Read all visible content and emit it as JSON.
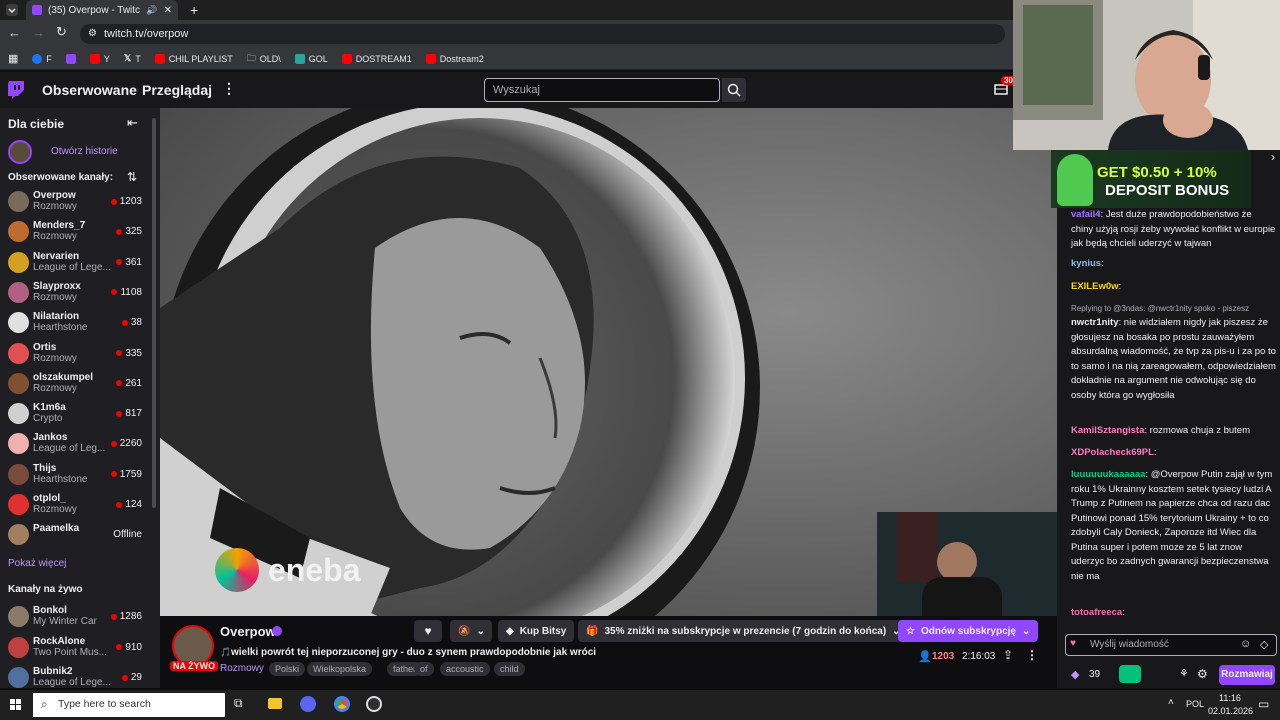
{
  "browser": {
    "tab_title": "(35) Overpow - Twitch",
    "url": "twitch.tv/overpow",
    "bookmarks": [
      {
        "label": "F",
        "color": "#1877f2"
      },
      {
        "label": "",
        "color": "#9146ff"
      },
      {
        "label": "Y",
        "color": "#ff0000"
      },
      {
        "label": "T",
        "color": "#ffffff"
      },
      {
        "label": "CHIL PLAYLIST",
        "color": "#ff0000"
      },
      {
        "label": "OLD\\",
        "color": "#e8eaed"
      },
      {
        "label": "GOL",
        "color": "#26a69a"
      },
      {
        "label": "DOSTREAM1",
        "color": "#ff0000"
      },
      {
        "label": "Dostream2",
        "color": "#ff0000"
      }
    ]
  },
  "nav": {
    "followed": "Obserwowane",
    "browse": "Przeglądaj",
    "search_placeholder": "Wyszukaj",
    "notif_count": "30"
  },
  "sidebar": {
    "for_you": "Dla ciebie",
    "open_stories": "Otwórz historie",
    "followed_header": "Obserwowane kanały:",
    "channels": [
      {
        "name": "Overpow",
        "game": "Rozmowy",
        "viewers": "1203",
        "color": "#7a6a5a"
      },
      {
        "name": "Menders_7",
        "game": "Rozmowy",
        "viewers": "325",
        "color": "#c06a30"
      },
      {
        "name": "Nervarien",
        "game": "League of Lege...",
        "viewers": "361",
        "color": "#d4a020"
      },
      {
        "name": "Slayproxx",
        "game": "Rozmowy",
        "viewers": "1108",
        "color": "#b06080"
      },
      {
        "name": "Nilatarion",
        "game": "Hearthstone",
        "viewers": "38",
        "color": "#e0e0e0"
      },
      {
        "name": "Ortis",
        "game": "Rozmowy",
        "viewers": "335",
        "color": "#e05050"
      },
      {
        "name": "olszakumpel",
        "game": "Rozmowy",
        "viewers": "261",
        "color": "#805030"
      },
      {
        "name": "K1m6a",
        "game": "Crypto",
        "viewers": "817",
        "color": "#d0d0d0"
      },
      {
        "name": "Jankos",
        "game": "League of Leg...",
        "viewers": "2260",
        "color": "#f0b0b0"
      },
      {
        "name": "Thijs",
        "game": "Hearthstone",
        "viewers": "1759",
        "color": "#7a4a3a"
      },
      {
        "name": "otplol_",
        "game": "Rozmowy",
        "viewers": "124",
        "color": "#e03030"
      },
      {
        "name": "Paamelka",
        "game": "",
        "viewers": "Offline",
        "color": "#a08060"
      }
    ],
    "show_more": "Pokaż więcej",
    "live_header": "Kanały na żywo",
    "live_channels": [
      {
        "name": "Bonkol",
        "game": "My Winter Car",
        "viewers": "1286",
        "color": "#8a7a6a"
      },
      {
        "name": "RockAlone",
        "game": "Two Point Mus...",
        "viewers": "910",
        "color": "#c04040"
      },
      {
        "name": "Bubnik2",
        "game": "League of Lege...",
        "viewers": "29",
        "color": "#5070a0"
      }
    ]
  },
  "video": {
    "watermark": "eneba"
  },
  "stream": {
    "channel": "Overpow",
    "live_badge": "NA ŻYWO",
    "title": "wielki powrót tej nieporzuconej gry - duo z synem prawdopodobnie jak wróci",
    "category": "Rozmowy",
    "tags": [
      "Polski",
      "Wielkopolska",
      "father",
      "of",
      "accoustic",
      "child"
    ],
    "viewers": "1203",
    "uptime": "2:16:03",
    "bits_button": "Kup Bitsy",
    "promo": "35% zniżki na subskrypcje w prezencie (7 godzin do końca)",
    "resub_button": "Odnów subskrypcję"
  },
  "chat": {
    "banner_line1": "GET $0.50 + 10%",
    "banner_line2": "DEPOSIT BONUS",
    "messages": [
      {
        "user": "vafail4",
        "color": "#a970ff",
        "text": ": Jest duże prawdopodobieństwo że chiny użyją rosji żeby wywołać konflikt w europie jak będą chcieli uderzyć w tajwan"
      },
      {
        "user": "kynius",
        "color": "#8fb4ff",
        "text": ":"
      },
      {
        "user": "EXILEw0w",
        "color": "#ffd700",
        "text": ":"
      },
      {
        "user": "",
        "color": "#adadb8",
        "text": "Replying to @3ndas: @nwctr1nity spoko - piszesz"
      },
      {
        "user": "nwctr1nity",
        "color": "#efeff1",
        "text": ": nie widziałem nigdy jak piszesz że głosujesz na bosaka po prostu zauważyłem absurdalną wiadomość, że tvp za pis-u i za po to to samo i na nią zareagowałem, odpowiedziałem dokładnie na argument nie odwołując się do osoby która go wygłosiła"
      },
      {
        "user": "KamilSztangista",
        "color": "#ff7ac6",
        "text": ": rozmowa chuja z butem"
      },
      {
        "user": "XDPolacheck69PL",
        "color": "#ff7ac6",
        "text": ":"
      },
      {
        "user": "luuuuuukaaaaaa",
        "color": "#00d084",
        "text": ": @Overpow Putin zajął w tym roku 1% Ukrainny kosztem setek tysiecy ludzi A Trump z Putinem na papierze chca od razu dac Putinowi ponad 15% terytorium Ukrainy + to co zdobyli Caly Donieck, Zaporoze itd Wiec dla Putina super i potem moze ze 5 lat znow uderzyc bo zadnych gwarancji bezpieczenstwa nie ma"
      },
      {
        "user": "totoafreeca",
        "color": "#ff6bb5",
        "text": ":"
      }
    ],
    "input_placeholder": "Wyślij wiadomość",
    "points": "39",
    "chat_button": "Rozmawiaj"
  },
  "taskbar": {
    "search_placeholder": "Type here to search",
    "lang": "POL",
    "time": "11:16",
    "date": "02.01.2026"
  }
}
